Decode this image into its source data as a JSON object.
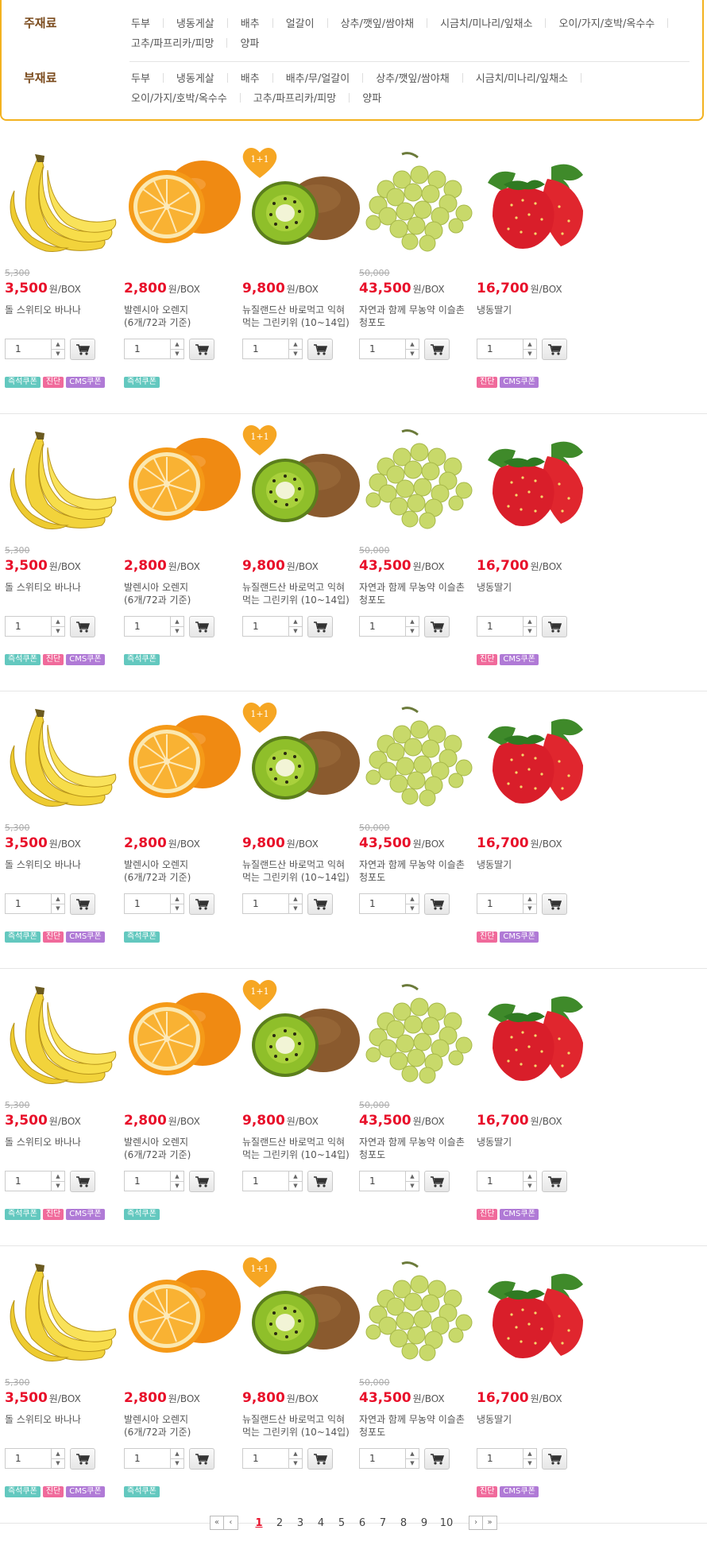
{
  "categories": {
    "main": {
      "title": "주재료",
      "items": [
        "두부",
        "냉동게살",
        "배추",
        "얼갈이",
        "상추/깻잎/쌈야채",
        "시금치/미나리/잎채소",
        "오이/가지/호박/옥수수",
        "고추/파프리카/피망",
        "양파"
      ]
    },
    "sub": {
      "title": "부재료",
      "items": [
        "두부",
        "냉동게살",
        "배추",
        "배추/무/얼갈이",
        "상추/깻잎/쌈야채",
        "시금치/미나리/잎채소",
        "오이/가지/호박/옥수수",
        "고추/파프리카/피망",
        "양파"
      ]
    }
  },
  "products": [
    {
      "image": "banana",
      "old_price": "5,300",
      "price": "3,500",
      "unit": "원/BOX",
      "name": [
        "돌 스위티오 바나나"
      ],
      "qty": "1",
      "badges": [
        "즉석쿠폰",
        "진단",
        "CMS쿠폰"
      ],
      "promo": ""
    },
    {
      "image": "orange",
      "old_price": "",
      "price": "2,800",
      "unit": "원/BOX",
      "name": [
        "발렌시아 오렌지",
        "(6개/72과 기준)"
      ],
      "qty": "1",
      "badges": [
        "즉석쿠폰"
      ],
      "promo": ""
    },
    {
      "image": "kiwi",
      "old_price": "",
      "price": "9,800",
      "unit": "원/BOX",
      "name": [
        "뉴질랜드산 바로먹고 익혀",
        "먹는 그린키위 (10~14입)"
      ],
      "qty": "1",
      "badges": [],
      "promo": "1+1"
    },
    {
      "image": "grape",
      "old_price": "50,000",
      "price": "43,500",
      "unit": "원/BOX",
      "name": [
        "자연과 함께 무농약 이슬촌",
        "청포도"
      ],
      "qty": "1",
      "badges": [],
      "promo": ""
    },
    {
      "image": "strawberry",
      "old_price": "",
      "price": "16,700",
      "unit": "원/BOX",
      "name": [
        "냉동딸기"
      ],
      "qty": "1",
      "badges": [
        "진단",
        "CMS쿠폰"
      ],
      "promo": ""
    }
  ],
  "badge_colors": {
    "즉석쿠폰": "#63c8bf",
    "진단": "#f06a9b",
    "CMS쿠폰": "#b07ad6"
  },
  "pagination": {
    "pages": [
      "1",
      "2",
      "3",
      "4",
      "5",
      "6",
      "7",
      "8",
      "9",
      "10"
    ],
    "current": "1",
    "first_icon": "double-left-icon",
    "prev_icon": "left-icon",
    "next_icon": "right-icon",
    "last_icon": "double-right-icon"
  }
}
